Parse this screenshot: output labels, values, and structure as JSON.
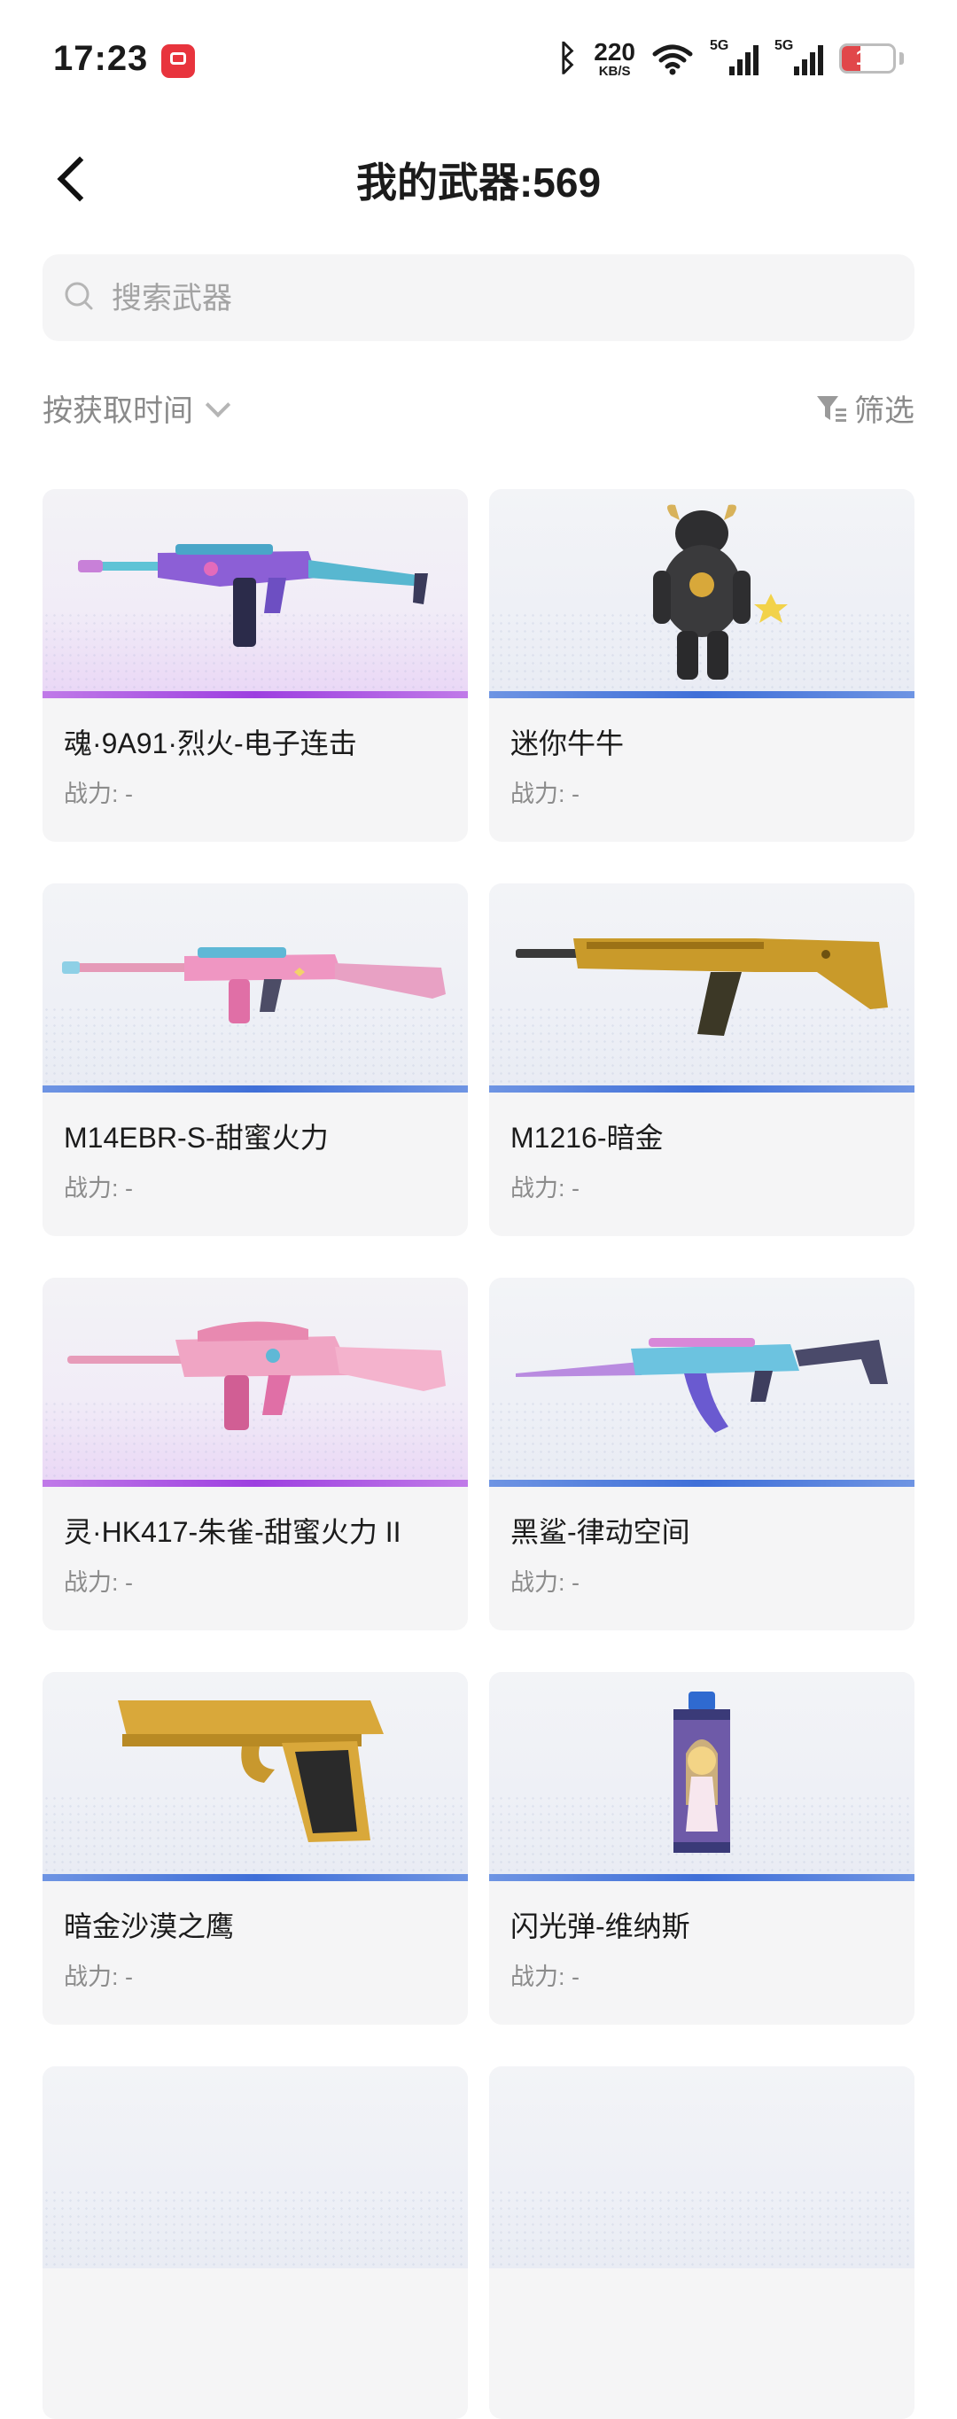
{
  "status_bar": {
    "time": "17:23",
    "net_speed": "220",
    "net_unit": "KB/S",
    "sim1": "5G",
    "sim2": "5G",
    "battery": "15"
  },
  "header": {
    "title": "我的武器:569"
  },
  "search": {
    "placeholder": "搜索武器"
  },
  "toolbar": {
    "sort_label": "按获取时间",
    "filter_label": "筛选"
  },
  "colors": {
    "blue_bar": "#3f6fd8",
    "purple_bar": "#9d3fe0",
    "battery_low": "#e1474a"
  },
  "weapons": [
    {
      "name": "魂·9A91·烈火-电子连击",
      "power": "战力: -",
      "rarity": "purple",
      "icon": "smg-icon"
    },
    {
      "name": "迷你牛牛",
      "power": "战力: -",
      "rarity": "blue",
      "icon": "bull-figure-icon"
    },
    {
      "name": "M14EBR-S-甜蜜火力",
      "power": "战力: -",
      "rarity": "blue",
      "icon": "rifle-icon"
    },
    {
      "name": "M1216-暗金",
      "power": "战力: -",
      "rarity": "blue",
      "icon": "shotgun-icon"
    },
    {
      "name": "灵·HK417-朱雀-甜蜜火力 II",
      "power": "战力: -",
      "rarity": "purple",
      "icon": "rifle-icon"
    },
    {
      "name": "黑鲨-律动空间",
      "power": "战力: -",
      "rarity": "blue",
      "icon": "rifle-icon"
    },
    {
      "name": "暗金沙漠之鹰",
      "power": "战力: -",
      "rarity": "blue",
      "icon": "pistol-icon"
    },
    {
      "name": "闪光弹-维纳斯",
      "power": "战力: -",
      "rarity": "blue",
      "icon": "flashbang-icon"
    },
    {
      "name": "",
      "power": "",
      "rarity": "blue",
      "icon": ""
    },
    {
      "name": "",
      "power": "",
      "rarity": "blue",
      "icon": ""
    }
  ]
}
